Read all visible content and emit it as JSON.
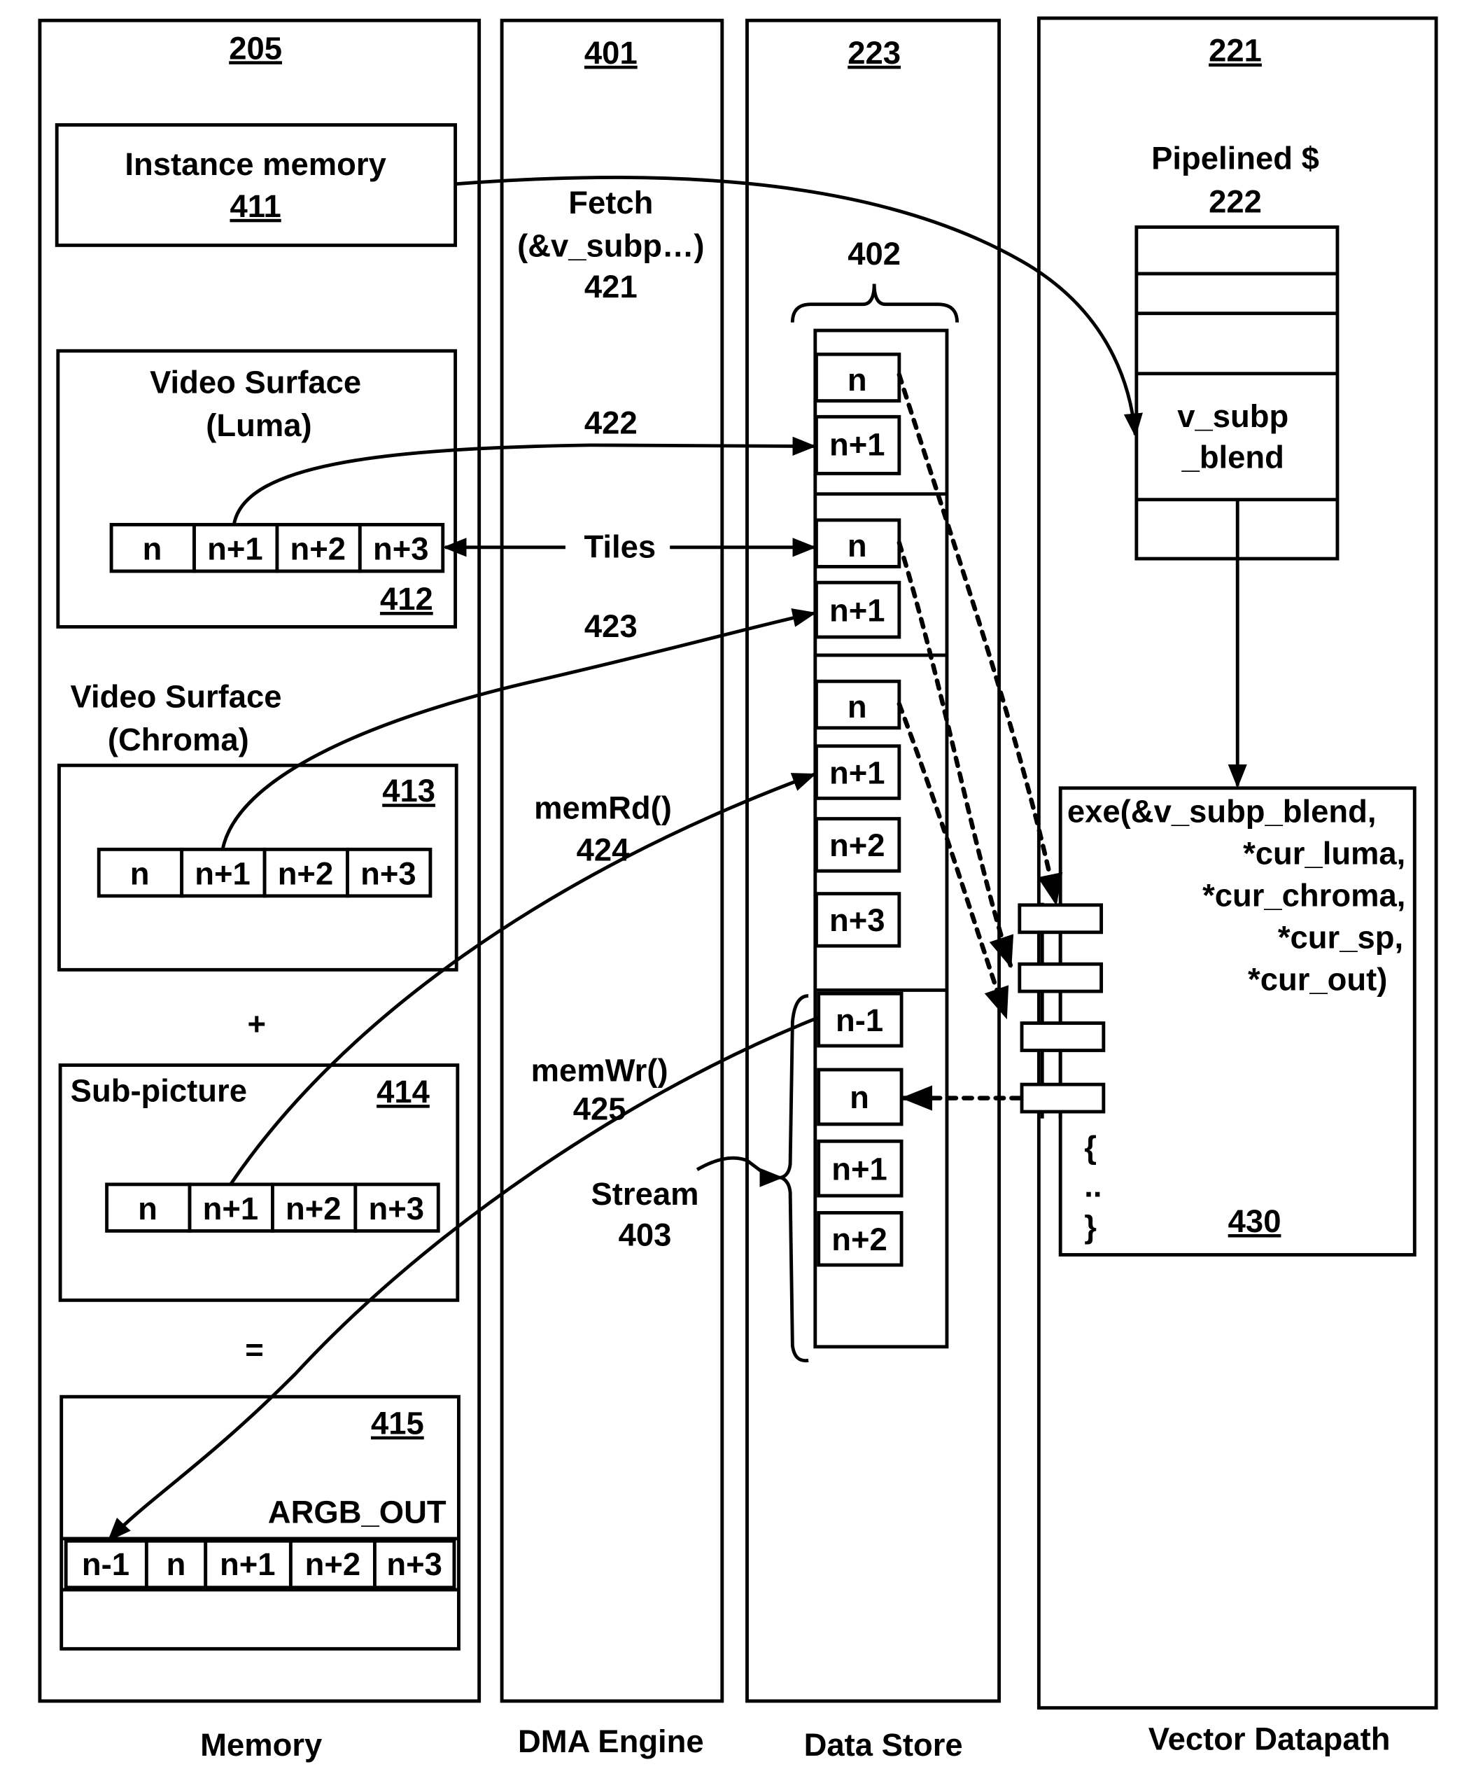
{
  "columns": {
    "memory": {
      "ref": "205",
      "caption": "Memory"
    },
    "dma": {
      "ref": "401",
      "caption": "DMA Engine"
    },
    "data_store": {
      "ref": "223",
      "caption": "Data Store"
    },
    "vector": {
      "ref": "221",
      "caption": "Vector Datapath"
    }
  },
  "memory": {
    "instance": {
      "label": "Instance memory",
      "ref": "411"
    },
    "luma": {
      "title1": "Video Surface",
      "title2": "(Luma)",
      "ref": "412",
      "cells": [
        "n",
        "n+1",
        "n+2",
        "n+3"
      ]
    },
    "chroma": {
      "title1": "Video Surface",
      "title2": "(Chroma)",
      "ref": "413",
      "cells": [
        "n",
        "n+1",
        "n+2",
        "n+3"
      ]
    },
    "plus": "+",
    "subpicture": {
      "label": "Sub-picture",
      "ref": "414",
      "cells": [
        "n",
        "n+1",
        "n+2",
        "n+3"
      ]
    },
    "equals": "=",
    "output": {
      "ref": "415",
      "label": "ARGB_OUT",
      "cells": [
        "n-1",
        "n",
        "n+1",
        "n+2",
        "n+3"
      ]
    }
  },
  "dma": {
    "fetch": {
      "line1": "Fetch",
      "line2": "(&v_subp…)",
      "ref": "421"
    },
    "ref_422": "422",
    "tiles": "Tiles",
    "ref_423": "423",
    "memrd": {
      "label": "memRd()",
      "ref": "424"
    },
    "memwr": {
      "label": "memWr()",
      "ref": "425"
    },
    "stream": {
      "label": "Stream",
      "ref": "403"
    }
  },
  "data_store": {
    "ref_402": "402",
    "group1": [
      "n",
      "n+1"
    ],
    "group2": [
      "n",
      "n+1"
    ],
    "group3": [
      "n",
      "n+1",
      "n+2",
      "n+3"
    ],
    "group4": [
      "n-1",
      "n",
      "n+1",
      "n+2"
    ]
  },
  "vector": {
    "cache": {
      "line1": "Pipelined $",
      "ref": "222",
      "entry1": "v_subp",
      "entry2": "_blend"
    },
    "exe": {
      "lines": [
        "exe(&v_subp_blend,",
        "*cur_luma,",
        "*cur_chroma,",
        "*cur_sp,",
        "*cur_out)"
      ],
      "open_brace": "{",
      "ellipsis": "..",
      "close_brace": "}",
      "ref": "430"
    }
  }
}
